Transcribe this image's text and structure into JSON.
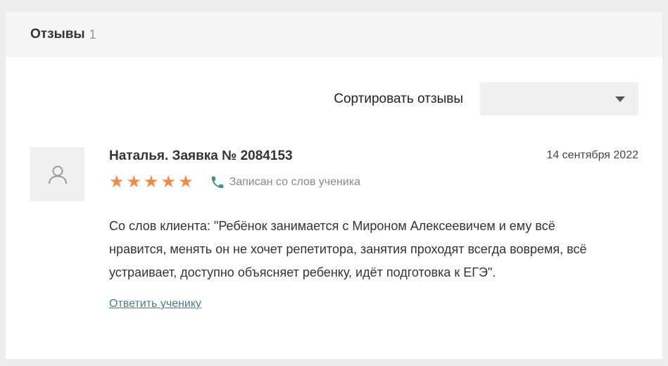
{
  "header": {
    "title": "Отзывы",
    "count": "1"
  },
  "sort": {
    "label": "Сортировать отзывы",
    "selected": ""
  },
  "review": {
    "title": "Наталья. Заявка № 2084153",
    "date": "14 сентября 2022",
    "rating": 5,
    "rating_max": 5,
    "star_color": "#f08a4b",
    "source_icon": "phone-icon",
    "source_label": "Записан со слов ученика",
    "text": "Со слов клиента: \"Ребёнок занимается с Мироном Алексеевичем и ему всё нравится, менять он не хочет репетитора, занятия проходят всегда вовремя, всё устраивает, доступно объясняет ребенку, идёт подготовка к ЕГЭ\".",
    "reply_label": "Ответить ученику"
  },
  "colors": {
    "accent_link": "#4a7c86",
    "phone": "#4a8a94"
  }
}
